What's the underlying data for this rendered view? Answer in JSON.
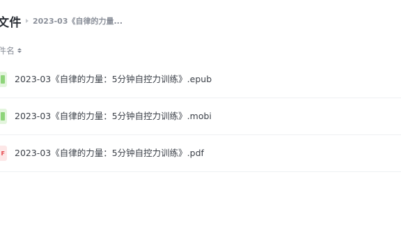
{
  "header": {
    "title": "文件",
    "breadcrumb_current": "2023-03《自律的力量..."
  },
  "column_header": {
    "name_label": "件名"
  },
  "files": [
    {
      "name": "2023-03《自律的力量：5分钟自控力训练》.epub",
      "icon": "epub-file-icon",
      "icon_color": "#8ed47a"
    },
    {
      "name": "2023-03《自律的力量：5分钟自控力训练》.mobi",
      "icon": "mobi-file-icon",
      "icon_color": "#8ed47a"
    },
    {
      "name": "2023-03《自律的力量：5分钟自控力训练》.pdf",
      "icon": "pdf-file-icon",
      "icon_color": "#e5484d",
      "icon_letter": "F"
    }
  ],
  "colors": {
    "title": "#2b2f36",
    "muted": "#8a8f99",
    "divider": "#eef0f2"
  }
}
